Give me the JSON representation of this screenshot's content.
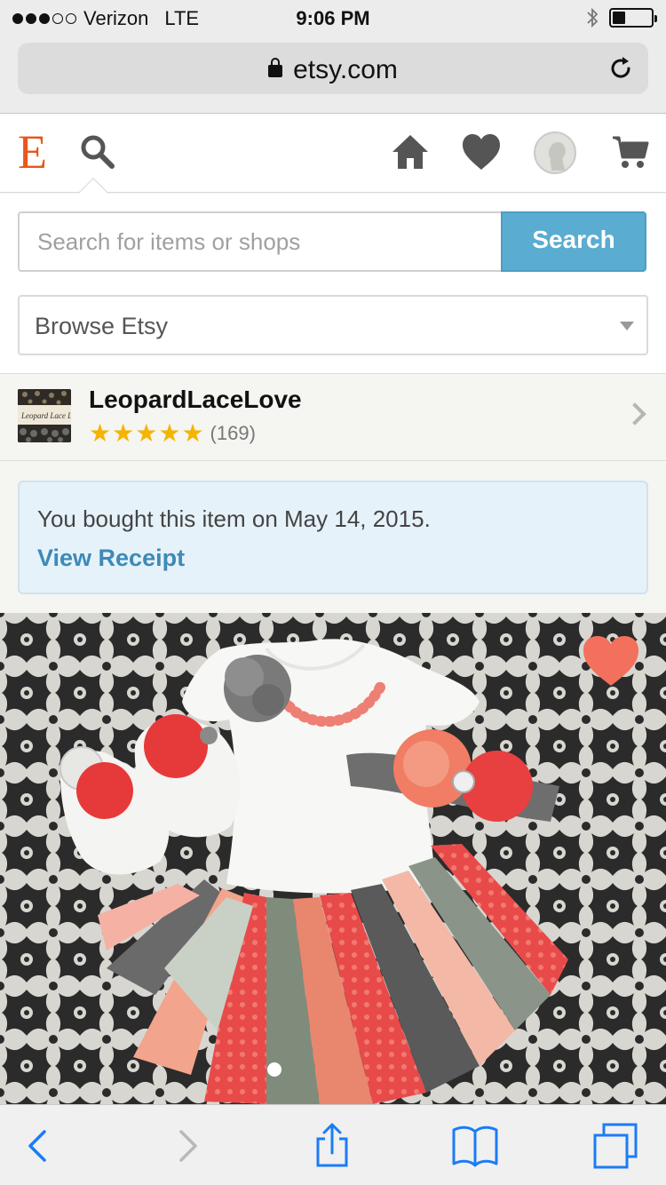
{
  "status_bar": {
    "carrier": "Verizon",
    "network": "LTE",
    "time": "9:06 PM",
    "signal_bars_filled": 3,
    "signal_bars_total": 5,
    "battery_level": 0.3
  },
  "browser": {
    "url": "etsy.com",
    "icons": [
      "lock-icon",
      "reload-icon"
    ]
  },
  "header": {
    "logo": "E",
    "icons": [
      "search-icon",
      "home-icon",
      "heart-icon",
      "avatar",
      "cart-icon"
    ],
    "brand_color": "#e8571b"
  },
  "search": {
    "placeholder": "Search for items or shops",
    "button_label": "Search",
    "button_color": "#5aacd0"
  },
  "browse": {
    "selected": "Browse Etsy"
  },
  "shop": {
    "name": "LeopardLaceLove",
    "stars": 5,
    "review_count": "(169)"
  },
  "purchase": {
    "message": "You bought this item on May 14, 2015.",
    "receipt_link": "View Receipt",
    "link_color": "#3d8ab8"
  },
  "product": {
    "favorite_icon": "heart-icon",
    "favorite_color": "#f2705c",
    "carousel_active_index": 0
  },
  "toolbar": {
    "icons": [
      "back-icon",
      "forward-icon",
      "share-icon",
      "bookmarks-icon",
      "tabs-icon"
    ],
    "accent": "#1b7cf6"
  }
}
